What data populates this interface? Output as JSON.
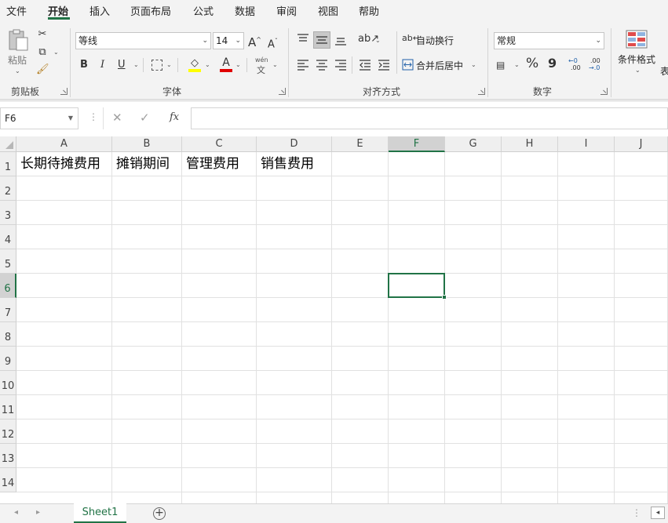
{
  "menu": {
    "tabs": [
      {
        "label": "文件"
      },
      {
        "label": "开始"
      },
      {
        "label": "插入"
      },
      {
        "label": "页面布局"
      },
      {
        "label": "公式"
      },
      {
        "label": "数据"
      },
      {
        "label": "审阅"
      },
      {
        "label": "视图"
      },
      {
        "label": "帮助"
      }
    ]
  },
  "ribbon": {
    "clipboard": {
      "paste_label": "粘贴",
      "group_label": "剪贴板"
    },
    "font": {
      "font_name": "等线",
      "font_size": "14",
      "group_label": "字体",
      "bold": "B",
      "italic": "I",
      "underline": "U",
      "grow": "A",
      "shrink": "A",
      "phonetic_top": "wén",
      "phonetic_bottom": "文"
    },
    "alignment": {
      "wrap_text": "自动换行",
      "merge_center": "合并后居中",
      "group_label": "对齐方式"
    },
    "number": {
      "format": "常规",
      "group_label": "数字",
      "percent": "%",
      "comma": "9",
      "inc_top": "←0",
      "inc_bottom": ".00",
      "dec_top": ".00",
      "dec_bottom": "→.0"
    },
    "styles": {
      "conditional_format": "条件格式",
      "table_format_partial": "表"
    }
  },
  "formula_bar": {
    "name_box": "F6",
    "fx_label": "fx",
    "cancel": "✕",
    "enter": "✓",
    "content": ""
  },
  "grid": {
    "columns": [
      "A",
      "B",
      "C",
      "D",
      "E",
      "F",
      "G",
      "H",
      "I",
      "J"
    ],
    "rows": [
      "1",
      "2",
      "3",
      "4",
      "5",
      "6",
      "7",
      "8",
      "9",
      "10",
      "11",
      "12",
      "13",
      "14"
    ],
    "cells": {
      "A1": "长期待摊费用",
      "B1": "摊销期间",
      "C1": "管理费用",
      "D1": "销售费用"
    },
    "active_cell": "F6"
  },
  "sheets": {
    "tabs": [
      {
        "label": "Sheet1"
      }
    ],
    "add_label": "+"
  },
  "colors": {
    "accent": "#217346",
    "ribbon_bg": "#f3f3f3",
    "gridline": "#e1e1e1"
  }
}
